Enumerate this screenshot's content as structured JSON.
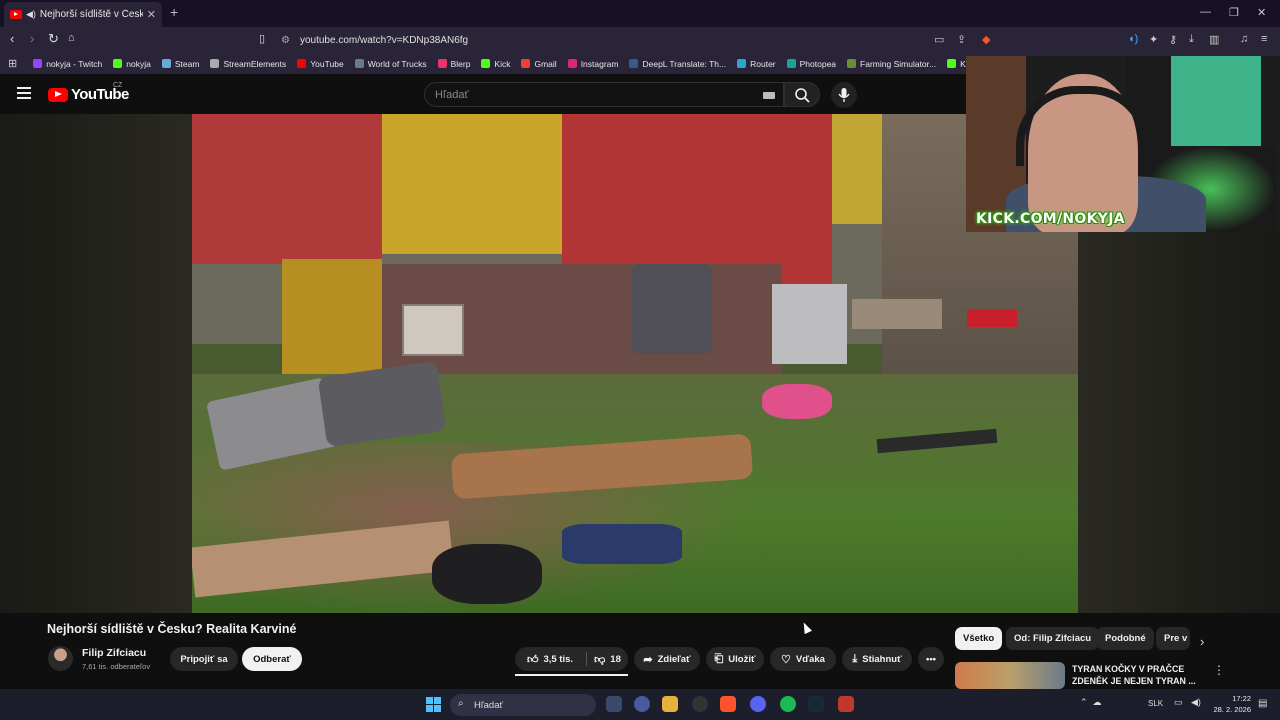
{
  "browser": {
    "tab_title": "Nejhorší sídliště v Česku? Re...",
    "url": "youtube.com/watch?v=KDNp38AN6fg",
    "bookmarks": [
      {
        "label": "nokyja - Twitch",
        "color": "#9146ff"
      },
      {
        "label": "nokyja",
        "color": "#53fc18"
      },
      {
        "label": "Steam",
        "color": "#1b2838"
      },
      {
        "label": "StreamElements",
        "color": "#1a1a1a"
      },
      {
        "label": "YouTube",
        "color": "#ff0000"
      },
      {
        "label": "World of Trucks",
        "color": "#6a7a8a"
      },
      {
        "label": "Blerp",
        "color": "#e8356a"
      },
      {
        "label": "Kick",
        "color": "#53fc18"
      },
      {
        "label": "Gmail",
        "color": "#ea4335"
      },
      {
        "label": "Instagram",
        "color": "#d62976"
      },
      {
        "label": "DeepL Translate: Th...",
        "color": "#0f2b46"
      },
      {
        "label": "Router",
        "color": "#2aa6d0"
      },
      {
        "label": "Photopea",
        "color": "#18a497"
      },
      {
        "label": "Farming Simulator...",
        "color": "#6b8a3a"
      },
      {
        "label": "Ko",
        "color": "#53fc18"
      }
    ]
  },
  "youtube": {
    "logo_text": "YouTube",
    "region": "CZ",
    "search_placeholder": "Hľadať"
  },
  "webcam": {
    "overlay_text": "KICK.COM/NOKYJA"
  },
  "video": {
    "title": "Nejhorší sídliště v Česku? Realita Karviné",
    "channel": "Filip Zifciacu",
    "subscribers": "7,61 tis. odberateľov",
    "join_label": "Pripojiť sa",
    "subscribe_label": "Odberať",
    "likes": "3,5 tis.",
    "dislikes": "18",
    "share_label": "Zdieľať",
    "save_label": "Uložiť",
    "thanks_label": "Vďaka",
    "download_label": "Stiahnuť"
  },
  "chips": {
    "all": "Všetko",
    "from": "Od: Filip Zifciacu",
    "similar": "Podobné",
    "pre": "Pre v"
  },
  "recommendation": {
    "title": "TYRAN KOČKY V PRAČCE ZDENĚK JE NEJEN TYRAN ..."
  },
  "taskbar": {
    "search_placeholder": "Hľadať",
    "language": "SLK",
    "time": "17:22",
    "date": "28. 2. 2026"
  }
}
